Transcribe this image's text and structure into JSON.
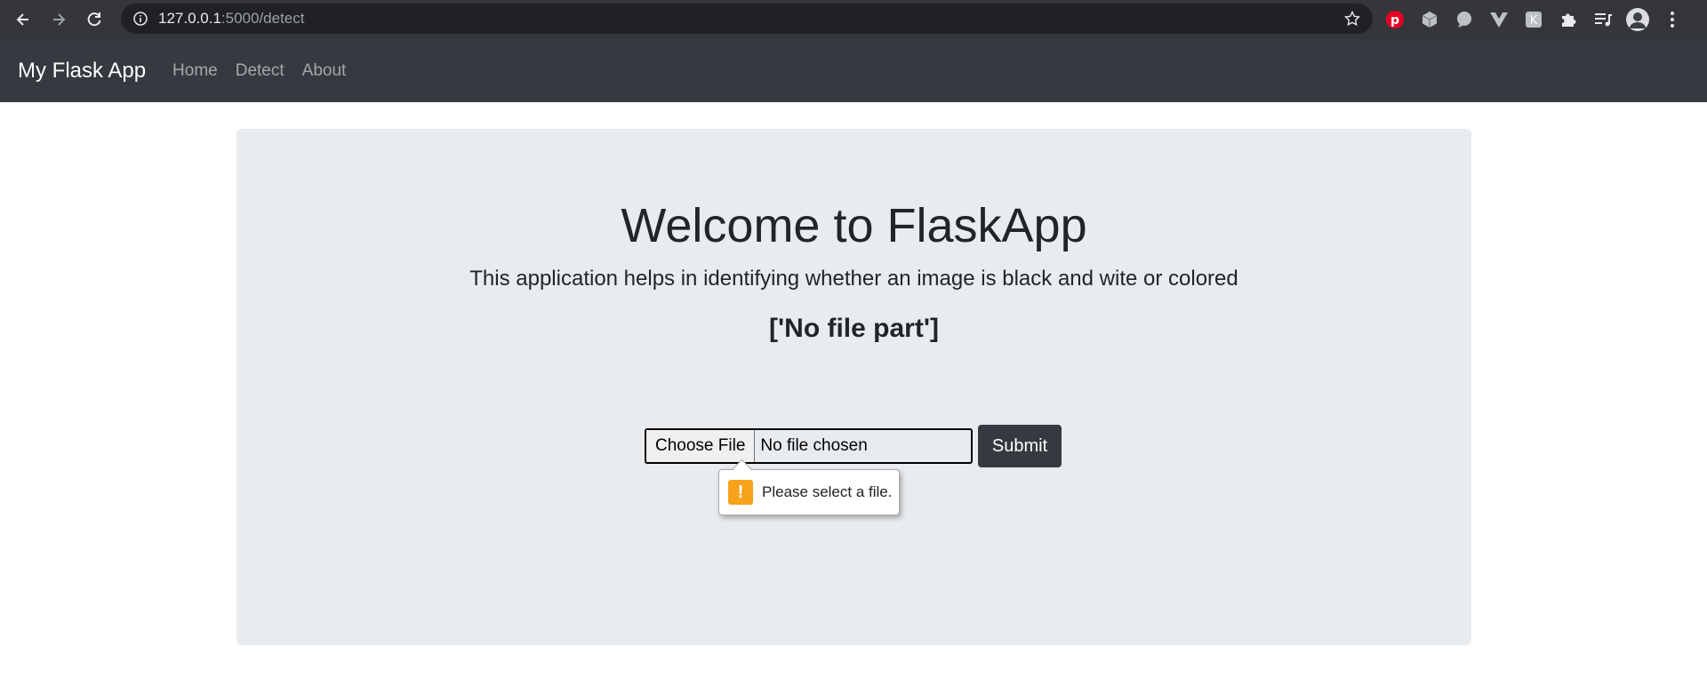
{
  "browser": {
    "url_host": "127.0.0.1",
    "url_path": ":5000/detect",
    "icons": {
      "back": "back-arrow-icon",
      "forward": "forward-arrow-icon",
      "reload": "reload-icon",
      "info": "info-icon",
      "bookmark": "star-icon"
    },
    "extensions": [
      "pinterest-icon",
      "cube-icon",
      "chat-icon",
      "vuejs-icon",
      "k-extension-icon",
      "puzzle-icon",
      "reading-list-icon",
      "profile-avatar",
      "menu-icon"
    ]
  },
  "navbar": {
    "brand": "My Flask App",
    "links": [
      "Home",
      "Detect",
      "About"
    ]
  },
  "main": {
    "title": "Welcome to FlaskApp",
    "lead": "This application helps in identifying whether an image is black and wite or colored",
    "message": "['No file part']",
    "file_button": "Choose File",
    "file_status": "No file chosen",
    "submit_label": "Submit",
    "validation_message": "Please select a file."
  },
  "colors": {
    "navbar_bg": "#343a40",
    "jumbotron_bg": "#e9ecef",
    "warning": "#f7a21b"
  }
}
